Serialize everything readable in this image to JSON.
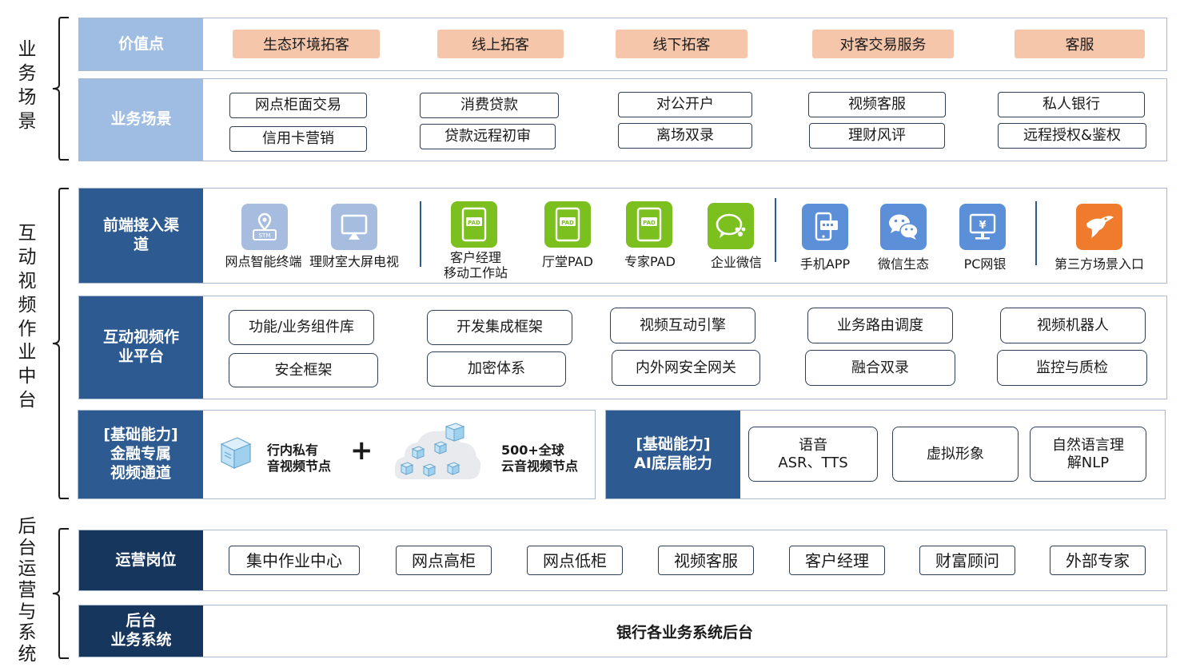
{
  "sections": {
    "business": "业务场景",
    "interaction": "互动视频作业中台",
    "backend": "后台运营与系统"
  },
  "value_row": {
    "head": "价值点",
    "chips": [
      "生态环境拓客",
      "线上拓客",
      "线下拓客",
      "对客交易服务",
      "客服"
    ]
  },
  "scene_row": {
    "head": "业务场景",
    "items": [
      "网点柜面交易",
      "信用卡营销",
      "消费贷款",
      "贷款远程初审",
      "对公开户",
      "离场双录",
      "视频客服",
      "理财风评",
      "私人银行",
      "远程授权&鉴权"
    ]
  },
  "channel_row": {
    "head": "前端接入渠道",
    "channels": [
      {
        "label": "网点智能终端",
        "icon": "stm-terminal-icon",
        "badge": "STM"
      },
      {
        "label": "理财室大屏电视",
        "icon": "screen-cast-icon"
      },
      {
        "label": "客户经理\n移动工作站",
        "icon": "pad-icon",
        "badge": "PAD"
      },
      {
        "label": "厅堂PAD",
        "icon": "pad-icon",
        "badge": "PAD"
      },
      {
        "label": "专家PAD",
        "icon": "pad-icon",
        "badge": "PAD"
      },
      {
        "label": "企业微信",
        "icon": "wecom-icon"
      },
      {
        "label": "手机APP",
        "icon": "mobile-app-icon"
      },
      {
        "label": "微信生态",
        "icon": "wechat-icon"
      },
      {
        "label": "PC网银",
        "icon": "pc-bank-icon",
        "badge": "¥"
      },
      {
        "label": "第三方场景入口",
        "icon": "third-party-icon"
      }
    ]
  },
  "platform_row": {
    "head": "互动视频作业平台",
    "items": [
      "功能/业务组件库",
      "安全框架",
      "开发集成框架",
      "加密体系",
      "视频互动引擎",
      "内外网安全网关",
      "业务路由调度",
      "融合双录",
      "视频机器人",
      "监控与质检"
    ]
  },
  "finance_row": {
    "head": "[基础能力]\n金融专属\n视频通道",
    "private_node": "行内私有\n音视频节点",
    "plus": "+",
    "global_node": "500+全球\n云音视频节点"
  },
  "ai_row": {
    "head": "[基础能力]\nAI底层能力",
    "items": [
      "语音\nASR、TTS",
      "虚拟形象",
      "自然语言理\n解NLP"
    ]
  },
  "ops_row": {
    "head": "运营岗位",
    "items": [
      "集中作业中心",
      "网点高柜",
      "网点低柜",
      "视频客服",
      "客户经理",
      "财富顾问",
      "外部专家"
    ]
  },
  "system_row": {
    "head": "后台\n业务系统",
    "content": "银行各业务系统后台"
  },
  "colors": {
    "head_light": "#9fbde3",
    "head_blue": "#2d5a91",
    "head_dark": "#17365d",
    "chip_peach": "#f6c6ab",
    "icon_gray": "#a7bde0",
    "icon_green": "#7cc01f",
    "icon_blue": "#5b8fd8",
    "icon_orange": "#f07b2d"
  }
}
